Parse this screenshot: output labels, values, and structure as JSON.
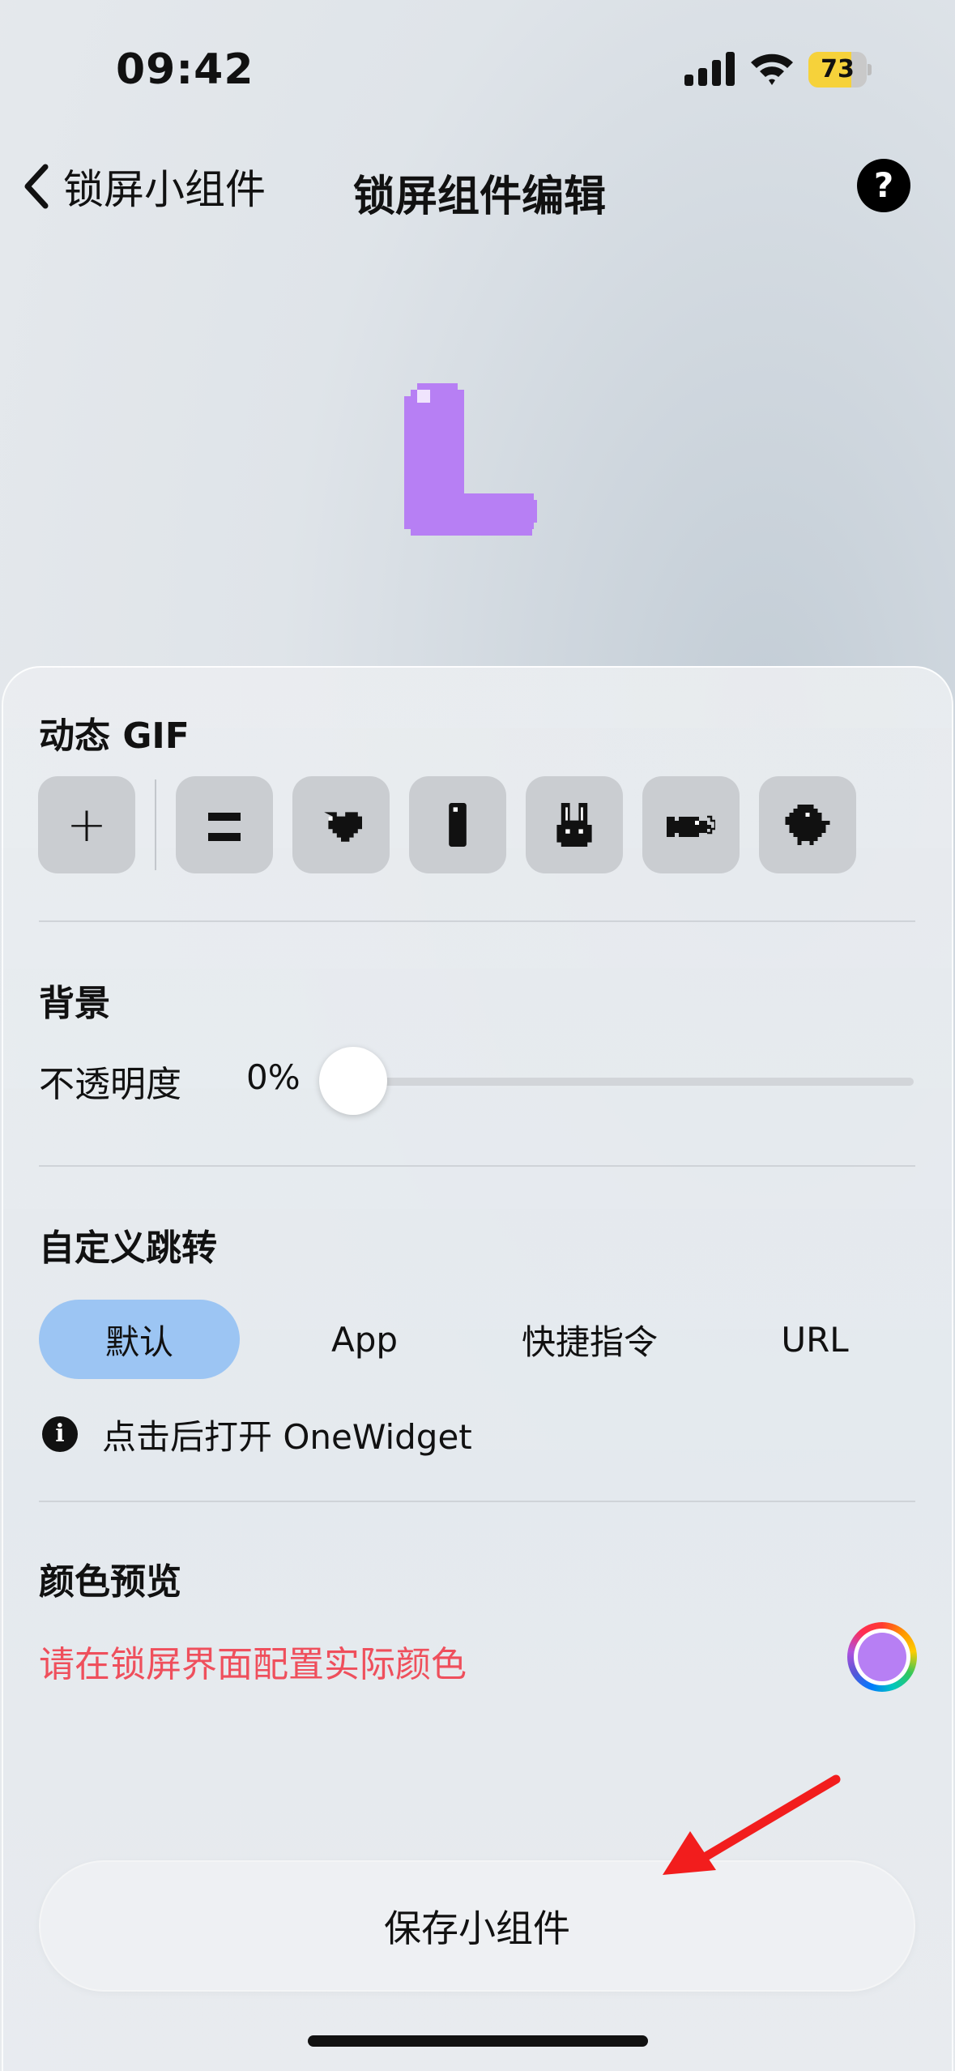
{
  "status_bar": {
    "time": "09:42",
    "battery_level": "73",
    "battery_fraction": 0.73
  },
  "nav": {
    "back_label": "锁屏小组件",
    "title": "锁屏组件编辑",
    "help_glyph": "?"
  },
  "preview": {
    "glyph_icon": "pixel-letter-L-icon",
    "color": "#b77ff4"
  },
  "gif_section": {
    "title": "动态 GIF",
    "add_glyph": "+",
    "items": [
      "z-pixel-icon",
      "heart-pixel-icon",
      "bar-pixel-icon",
      "bunny-pixel-icon",
      "fish-pixel-icon",
      "chick-pixel-icon"
    ]
  },
  "background_section": {
    "title": "背景",
    "opacity_label": "不透明度",
    "opacity_value": "0%",
    "opacity_fraction": 0
  },
  "jump_section": {
    "title": "自定义跳转",
    "options": [
      "默认",
      "App",
      "快捷指令",
      "URL"
    ],
    "selected": "默认",
    "info_glyph": "i",
    "info_text": "点击后打开 OneWidget"
  },
  "color_section": {
    "title": "颜色预览",
    "warning": "请在锁屏界面配置实际颜色",
    "swatch_color": "#b77ff4"
  },
  "save_button": {
    "label": "保存小组件"
  },
  "colors": {
    "accent_selected": "#9cc5f3",
    "warning_red": "#ef4f5c",
    "battery_yellow": "#f6d23a",
    "annotation_arrow": "#f21d1d"
  }
}
